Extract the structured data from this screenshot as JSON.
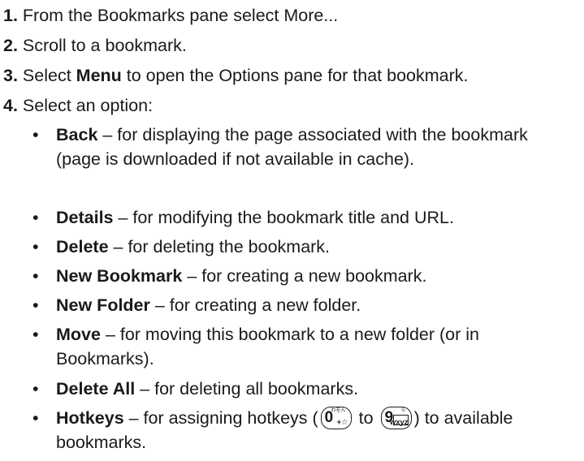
{
  "steps": [
    {
      "num": "1.",
      "text": "From the Bookmarks pane select More..."
    },
    {
      "num": "2.",
      "text": "Scroll to a bookmark."
    },
    {
      "num": "3.",
      "pre": "Select ",
      "bold": "Menu",
      "post": " to open the Options pane for that bookmark."
    },
    {
      "num": "4.",
      "text": "Select an option:"
    }
  ],
  "options": [
    {
      "term": "Back",
      "desc": " – for displaying the page associated with the bookmark (page is downloaded if not available in cache)."
    },
    {
      "term": "Details",
      "desc": " – for modifying the bookmark title and URL."
    },
    {
      "term": "Delete",
      "desc": " – for deleting the bookmark."
    },
    {
      "term": "New Bookmark",
      "desc": " – for creating a new bookmark."
    },
    {
      "term": "New Folder",
      "desc": " – for creating a new folder."
    },
    {
      "term": "Move",
      "desc": " – for moving this bookmark to a new folder (or in Bookmarks)."
    },
    {
      "term": "Delete All",
      "desc": " – for deleting all bookmarks."
    },
    {
      "term": "Hotkeys",
      "desc_pre": " – for assigning hotkeys (",
      "desc_mid": " to ",
      "desc_post": ") to available bookmarks."
    }
  ],
  "bullet_glyph": "•",
  "keys": {
    "zero": {
      "digit": "0",
      "sub": "+☆",
      "kana": "わをん"
    },
    "nine": {
      "digit": "9",
      "sub": "wxyz",
      "kana": "ら"
    }
  },
  "icons": {
    "key_zero": "keypad-0-icon",
    "key_nine": "keypad-9-icon"
  }
}
